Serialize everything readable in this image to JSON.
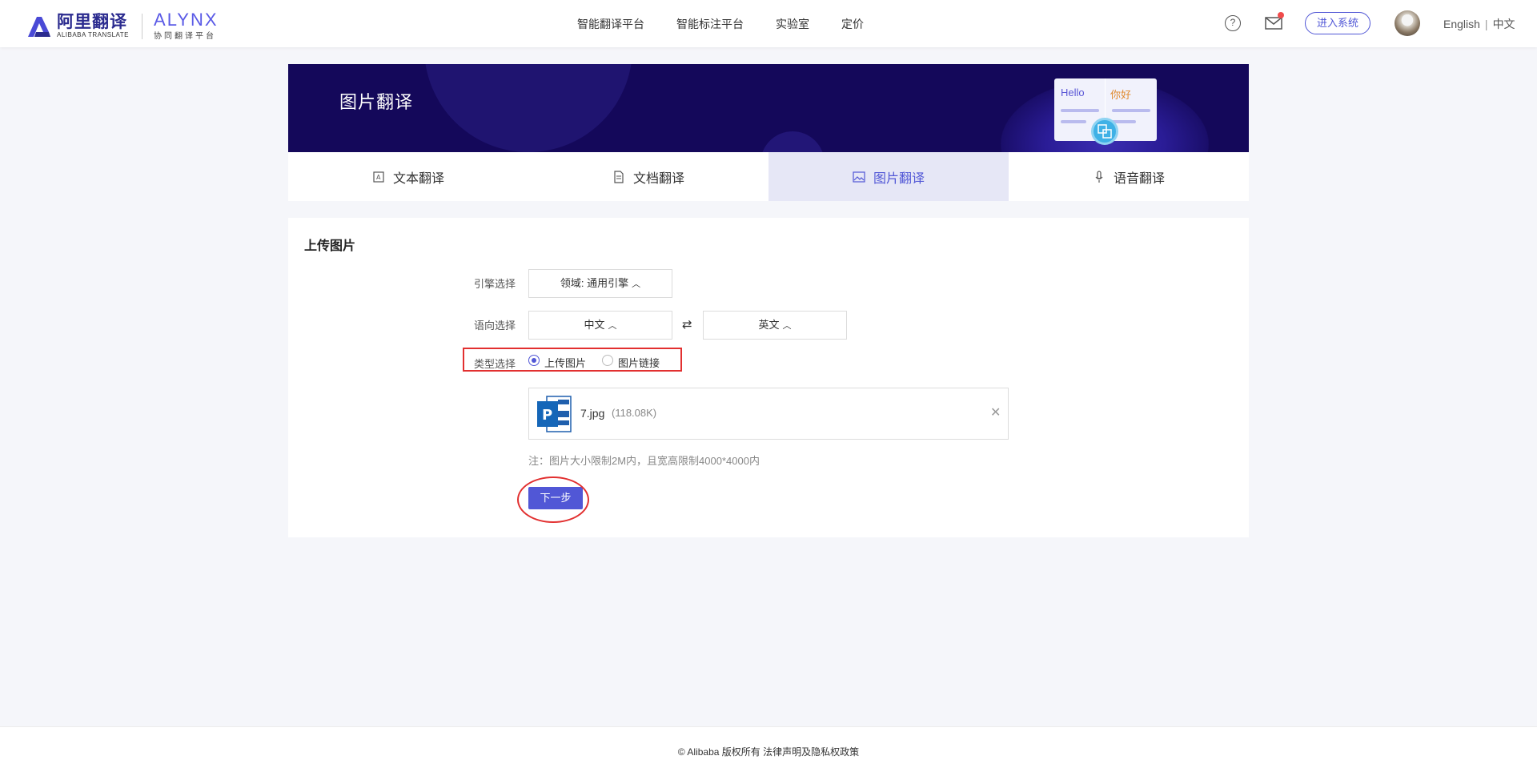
{
  "header": {
    "logo_cn": "阿里翻译",
    "logo_en": "ALIBABA TRANSLATE",
    "alynx": "ALYNX",
    "alynx_sub": "协同翻译平台",
    "nav": [
      "智能翻译平台",
      "智能标注平台",
      "实验室",
      "定价"
    ],
    "help_icon": "?",
    "enter_button": "进入系统",
    "lang_en": "English",
    "lang_sep": "|",
    "lang_cn": "中文"
  },
  "banner": {
    "title": "图片翻译",
    "card_hello": "Hello",
    "card_nihao": "你好"
  },
  "tabs": [
    {
      "label": "文本翻译",
      "icon": "text-translate-icon"
    },
    {
      "label": "文档翻译",
      "icon": "document-icon"
    },
    {
      "label": "图片翻译",
      "icon": "image-icon",
      "active": true
    },
    {
      "label": "语音翻译",
      "icon": "microphone-icon"
    }
  ],
  "upload": {
    "section_title": "上传图片",
    "engine_label": "引擎选择",
    "engine_value": "领域: 通用引擎",
    "direction_label": "语向选择",
    "source_lang": "中文",
    "target_lang": "英文",
    "swap_icon": "⇄",
    "caret": "︿",
    "type_label": "类型选择",
    "type_options": [
      "上传图片",
      "图片链接"
    ],
    "type_selected": 0,
    "file_name": "7.jpg",
    "file_size": "(118.08K)",
    "close_icon": "✕",
    "note": "注：图片大小限制2M内，且宽高限制4000*4000内",
    "next_button": "下一步"
  },
  "footer": {
    "text": "© Alibaba 版权所有 法律声明及隐私权政策"
  },
  "colors": {
    "accent": "#5157d6",
    "banner_bg": "#14085a",
    "highlight_red": "#e23030"
  }
}
